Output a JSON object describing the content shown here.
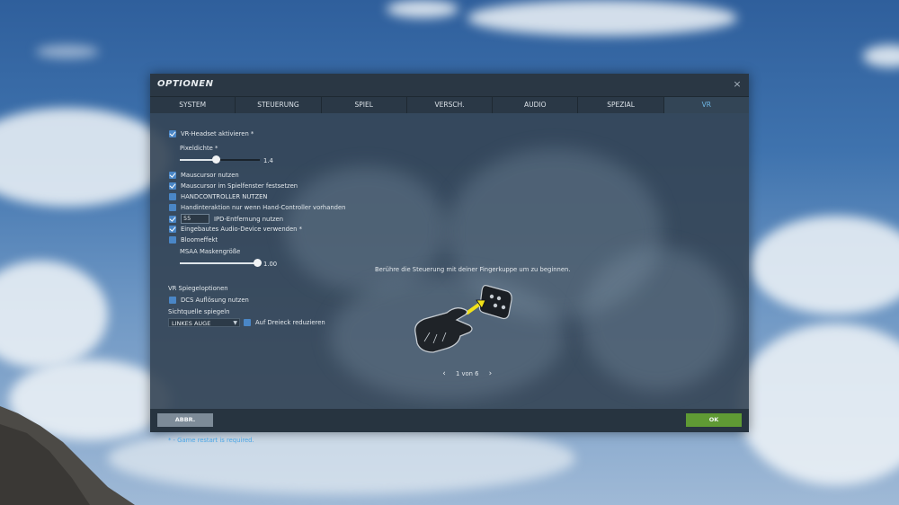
{
  "window": {
    "title": "OPTIONEN"
  },
  "tabs": [
    {
      "label": "SYSTEM"
    },
    {
      "label": "STEUERUNG"
    },
    {
      "label": "SPIEL"
    },
    {
      "label": "VERSCH."
    },
    {
      "label": "AUDIO"
    },
    {
      "label": "SPEZIAL"
    },
    {
      "label": "VR",
      "active": true
    }
  ],
  "vr": {
    "headset": {
      "label": "VR-Headset aktivieren *",
      "checked": true
    },
    "pixel_density": {
      "label": "Pixeldichte *",
      "value": "1.4",
      "fraction": 0.45
    },
    "mouse_cursor": {
      "label": "Mauscursor nutzen",
      "checked": true
    },
    "mouse_cursor_lock": {
      "label": "Mauscursor im Spielfenster festsetzen",
      "checked": true
    },
    "handcontroller": {
      "label": "HANDCONTROLLER NUTZEN",
      "checked": false
    },
    "hand_interaction": {
      "label": "Handinteraktion nur wenn Hand-Controller vorhanden",
      "checked": false
    },
    "ipd": {
      "label": "IPD-Entfernung nutzen",
      "checked": true,
      "value": "55"
    },
    "audio_device": {
      "label": "Eingebautes Audio-Device verwenden *",
      "checked": true
    },
    "bloom": {
      "label": "Bloomeffekt",
      "checked": false
    },
    "msaa": {
      "label": "MSAA Maskengröße",
      "value": "1.00",
      "fraction": 1.0
    },
    "mirror_section": "VR Spiegeloptionen",
    "dcs_resolution": {
      "label": "DCS Auflösung nutzen",
      "checked": false
    },
    "mirror_source": {
      "label": "Sichtquelle spiegeln",
      "value": "LINKES AUGE"
    },
    "triangle": {
      "label": "Auf Dreieck reduzieren",
      "checked": false
    }
  },
  "tutorial": {
    "hint": "Berühre die Steuerung mit deiner Fingerkuppe um zu beginnen.",
    "pager": "1 von 6",
    "prev_icon": "‹",
    "next_icon": "›"
  },
  "restart_note": "* - Game restart is required.",
  "buttons": {
    "cancel": "ABBR.",
    "ok": "OK"
  },
  "colors": {
    "accent": "#4a86c6",
    "active_tab": "#6fb8e6",
    "ok": "#5f9a34",
    "cancel": "#7d8b98"
  },
  "close_icon": "×"
}
